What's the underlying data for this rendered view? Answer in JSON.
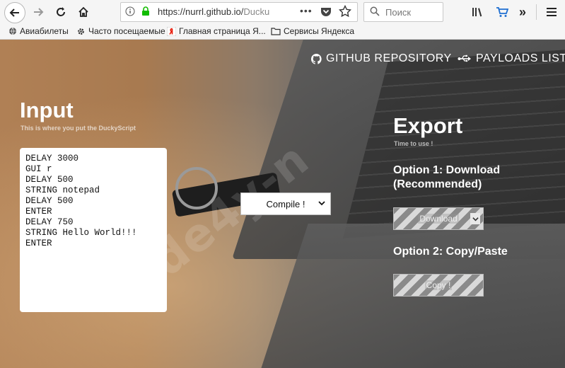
{
  "browser": {
    "url_prefix": "https://nurrl.github.io/",
    "url_rest": "Ducku",
    "search_placeholder": "Поиск",
    "more_glyph": "»"
  },
  "bookmarks": [
    {
      "label": "Авиабилеты"
    },
    {
      "label": "Часто посещаемые"
    },
    {
      "label": "Главная страница Я..."
    },
    {
      "label": "Сервисы Яндекса"
    }
  ],
  "nav": {
    "github": "GITHUB REPOSITORY",
    "payloads": "PAYLOADS LIST"
  },
  "input_section": {
    "title": "Input",
    "subtitle": "This is where you put the DuckyScript",
    "code": "DELAY 3000\nGUI r\nDELAY 500\nSTRING notepad\nDELAY 500\nENTER\nDELAY 750\nSTRING Hello World!!!\nENTER"
  },
  "compile": {
    "label": "Compile !"
  },
  "export_section": {
    "title": "Export",
    "subtitle": "Time to use !",
    "option1": "Option 1: Download (Recommended)",
    "download_label": "Download",
    "option2": "Option 2: Copy/Paste",
    "copy_label": "Copy !"
  },
  "watermark": "code4y-n"
}
